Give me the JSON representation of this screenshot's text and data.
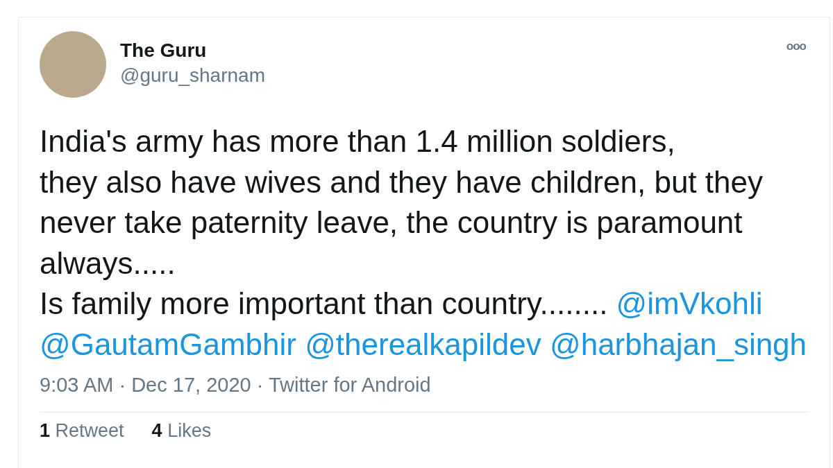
{
  "tweet": {
    "author": {
      "name": "The Guru",
      "handle": "@guru_sharnam"
    },
    "more_icon": "ooo",
    "body": {
      "text": "India's army has more than 1.4 million soldiers,\nthey also have wives and they have children, but they never take paternity leave, the country is paramount always.....\nIs family more important than country........ ",
      "mentions": [
        "@imVkohli",
        "@GautamGambhir",
        "@therealkapildev",
        "@harbhajan_singh"
      ]
    },
    "meta": "9:03 AM · Dec 17, 2020 · Twitter for Android",
    "stats": [
      {
        "count": "1",
        "label": "Retweet"
      },
      {
        "count": "4",
        "label": "Likes"
      }
    ]
  }
}
